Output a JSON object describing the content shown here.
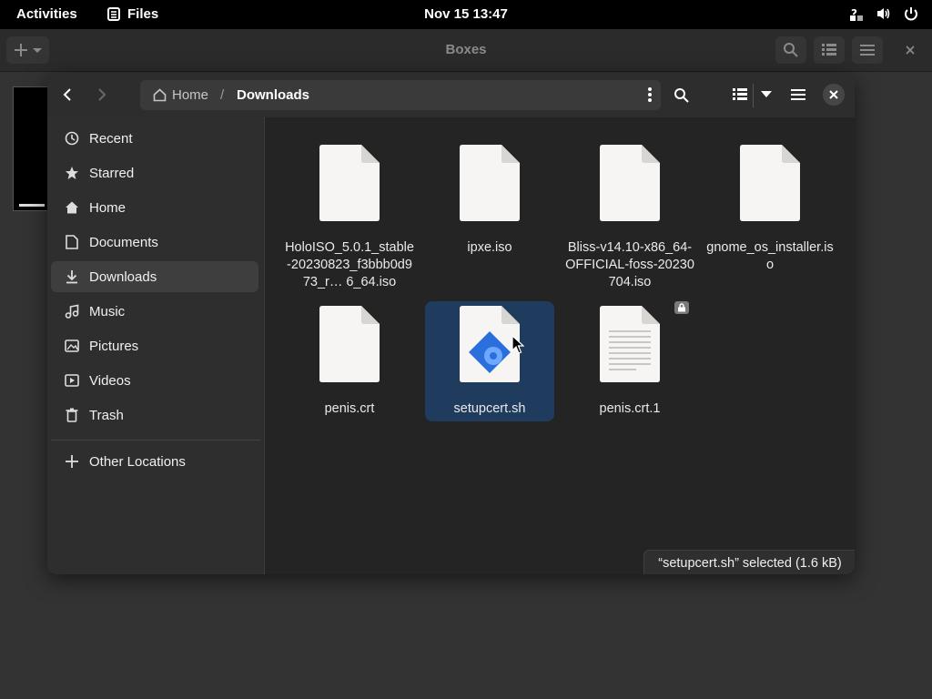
{
  "topbar": {
    "activities": "Activities",
    "app_name": "Files",
    "clock": "Nov 15  13:47",
    "status_icons": [
      "accessibility-icon",
      "volume-icon",
      "power-icon"
    ]
  },
  "boxes": {
    "title": "Boxes"
  },
  "dialog": {
    "path": {
      "home": "Home",
      "separator": "/",
      "current": "Downloads"
    },
    "sidebar": {
      "items": [
        {
          "label": "Recent",
          "icon": "clock-icon"
        },
        {
          "label": "Starred",
          "icon": "star-icon"
        },
        {
          "label": "Home",
          "icon": "home-icon"
        },
        {
          "label": "Documents",
          "icon": "document-icon"
        },
        {
          "label": "Downloads",
          "icon": "download-icon",
          "active": true
        },
        {
          "label": "Music",
          "icon": "music-icon"
        },
        {
          "label": "Pictures",
          "icon": "picture-icon"
        },
        {
          "label": "Videos",
          "icon": "video-icon"
        },
        {
          "label": "Trash",
          "icon": "trash-icon"
        }
      ],
      "other_locations": "Other Locations"
    },
    "files": [
      {
        "name": "HoloISO_5.0.1_stable-20230823_f3bbb0d973_r… 6_64.iso",
        "icon": "blank-file-icon"
      },
      {
        "name": "ipxe.iso",
        "icon": "blank-file-icon"
      },
      {
        "name": "Bliss-v14.10-x86_64-OFFICIAL-foss-20230704.iso",
        "icon": "blank-file-icon"
      },
      {
        "name": "gnome_os_installer.iso",
        "icon": "blank-file-icon"
      },
      {
        "name": "penis.crt",
        "icon": "blank-file-icon"
      },
      {
        "name": "setupcert.sh",
        "icon": "script-file-icon",
        "selected": true
      },
      {
        "name": "penis.crt.1",
        "icon": "text-file-icon",
        "locked": true
      }
    ],
    "status": "“setupcert.sh” selected  (1.6 kB)"
  }
}
